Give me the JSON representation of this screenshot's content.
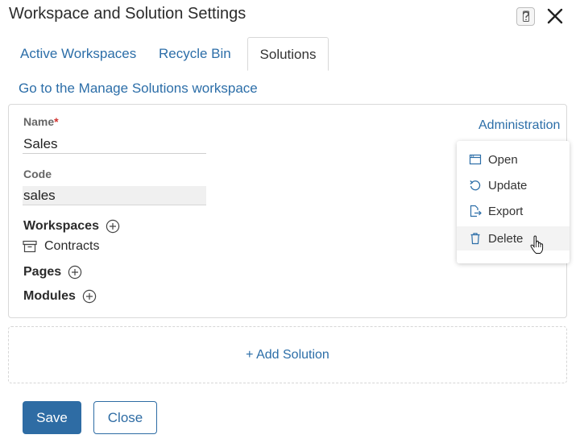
{
  "dialog": {
    "title": "Workspace and Solution Settings",
    "help_icon": "question-mark-icon",
    "close_icon": "close-icon"
  },
  "tabs": [
    {
      "label": "Active Workspaces",
      "active": false
    },
    {
      "label": "Recycle Bin",
      "active": false
    },
    {
      "label": "Solutions",
      "active": true
    }
  ],
  "manage_link": "Go to the Manage Solutions workspace",
  "solution": {
    "name_label": "Name",
    "required_mark": "*",
    "name_value": "Sales",
    "code_label": "Code",
    "code_value": "sales",
    "workspaces_label": "Workspaces",
    "workspaces": [
      {
        "icon": "archive-icon",
        "label": "Contracts"
      }
    ],
    "pages_label": "Pages",
    "modules_label": "Modules",
    "admin_label": "Administration"
  },
  "admin_menu": [
    {
      "label": "Open",
      "icon": "window-icon"
    },
    {
      "label": "Update",
      "icon": "refresh-icon"
    },
    {
      "label": "Export",
      "icon": "export-file-icon"
    },
    {
      "label": "Delete",
      "icon": "trash-icon",
      "hover": true
    }
  ],
  "add_solution": "+ Add Solution",
  "footer": {
    "save_label": "Save",
    "close_label": "Close"
  },
  "colors": {
    "link": "#2c6ea8",
    "primary_button": "#2e6ca4",
    "required": "#d0312d"
  }
}
